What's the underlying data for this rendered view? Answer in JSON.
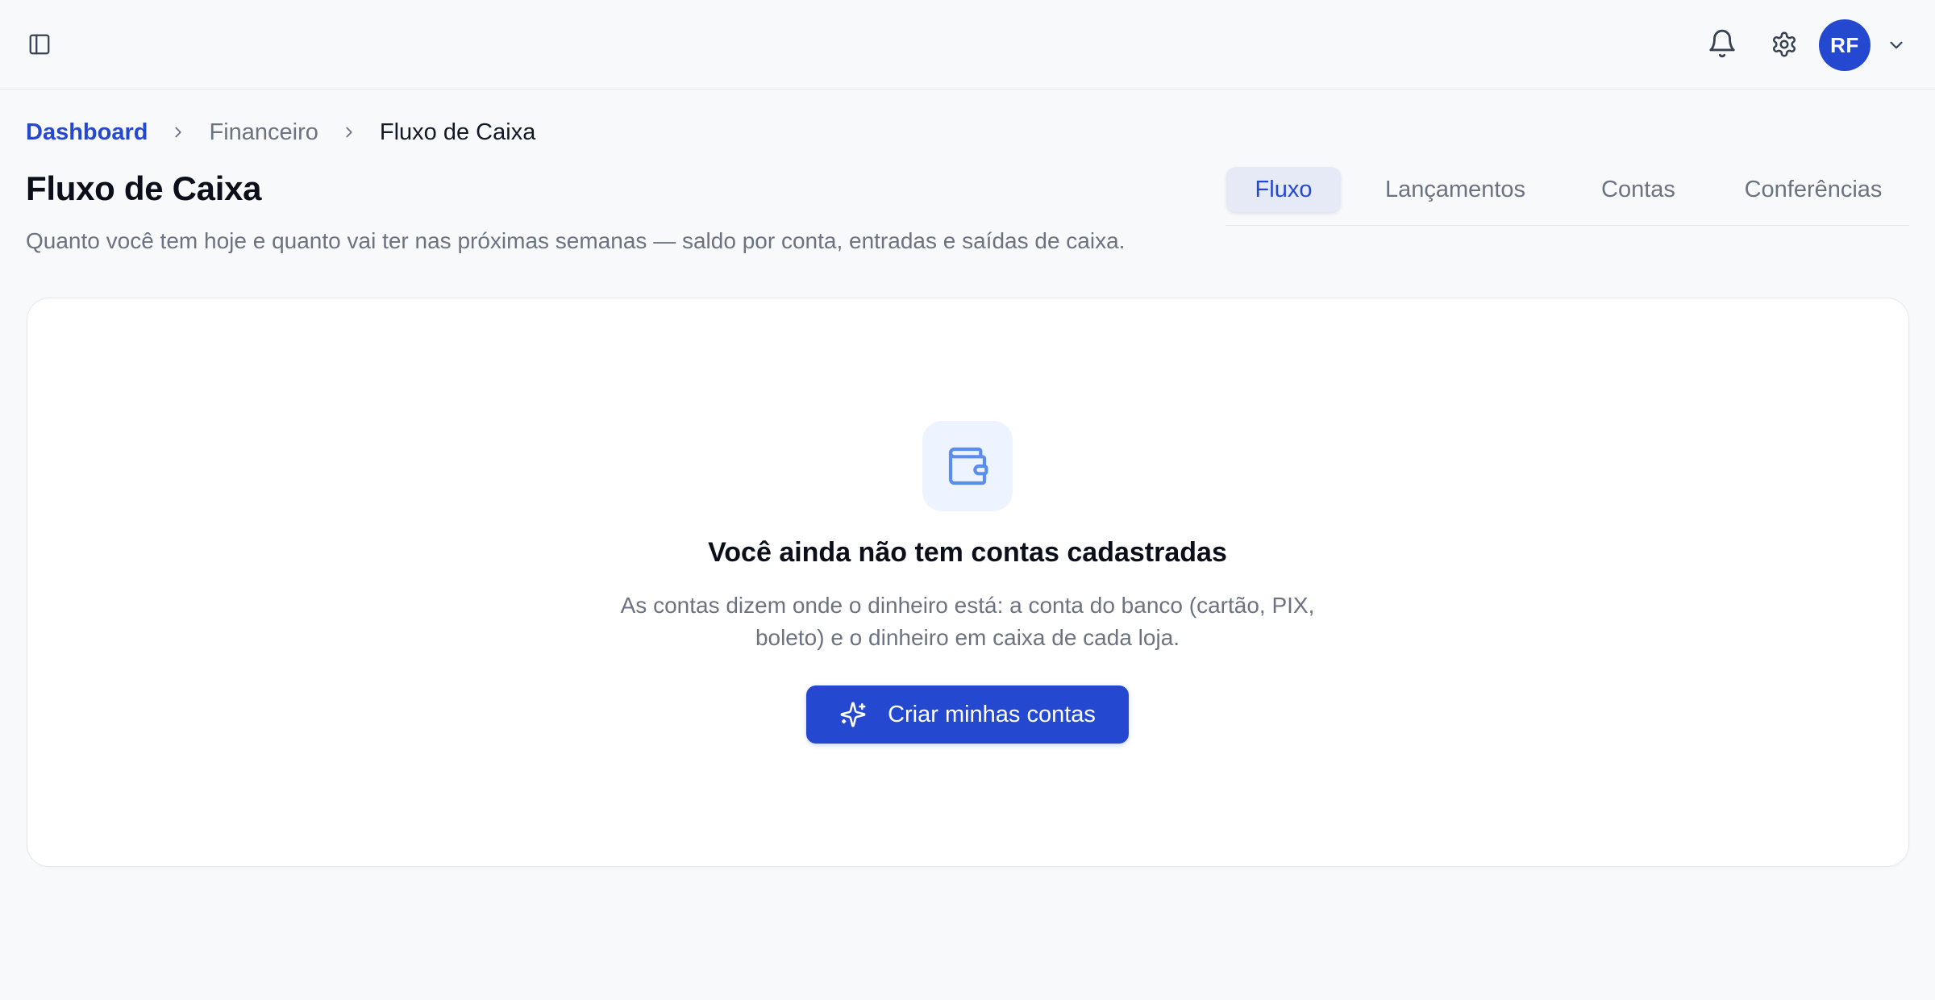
{
  "header": {
    "sidebar_toggle_icon": "sidebar-panel-icon",
    "notifications_icon": "bell-icon",
    "settings_icon": "gear-icon",
    "user_initials": "RF",
    "user_menu_icon": "chevron-down-icon"
  },
  "breadcrumb": {
    "items": [
      "Dashboard",
      "Financeiro",
      "Fluxo de Caixa"
    ]
  },
  "page": {
    "title": "Fluxo de Caixa",
    "subtitle": "Quanto você tem hoje e quanto vai ter nas próximas semanas — saldo por conta, entradas e saídas de caixa."
  },
  "tabs": [
    {
      "label": "Fluxo",
      "active": true
    },
    {
      "label": "Lançamentos",
      "active": false
    },
    {
      "label": "Contas",
      "active": false
    },
    {
      "label": "Conferências",
      "active": false
    }
  ],
  "empty_state": {
    "icon": "wallet-icon",
    "title": "Você ainda não tem contas cadastradas",
    "description": "As contas dizem onde o dinheiro está: a conta do banco (cartão, PIX, boleto) e o dinheiro em caixa de cada loja.",
    "button_label": "Criar minhas contas",
    "button_icon": "sparkles-icon"
  },
  "colors": {
    "accent": "#2449d0",
    "background": "#f8f9fb",
    "muted_text": "#6b7280",
    "icon_tint_bg": "#eef4ff",
    "icon_tint": "#5b8def"
  }
}
